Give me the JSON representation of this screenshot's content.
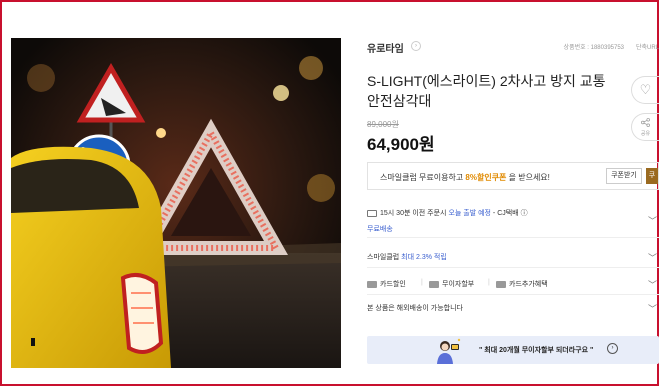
{
  "brand": {
    "name": "유로타임",
    "badge": "›"
  },
  "product_meta": {
    "product_no": "상품번호 : 1880395753",
    "short_url": "단축URL"
  },
  "title": "S-LIGHT(에스라이트) 2차사고 방지 교통 안전삼각대",
  "price": {
    "original": "89,000원",
    "sale": "64,900원"
  },
  "actions": {
    "wish_icon": "♡",
    "share_icon": "share",
    "share_label": "공유"
  },
  "coupon": {
    "text_prefix": "스마일클럽 무료이용하고 ",
    "text_highlight": "8%할인쿠폰",
    "text_suffix": " 을 받으세요!",
    "button": "쿠폰받기",
    "edge": "쿠"
  },
  "delivery": {
    "prefix": "15시 30분 이전 주문시 ",
    "highlight": "오늘 출발 예정",
    "suffix": " - CJ택배 ⓘ",
    "free": "무료배송"
  },
  "smile_club": {
    "prefix": "스마일클럽 ",
    "highlight": "최대 2.3% 적립"
  },
  "benefits": {
    "card_discount": "카드할인",
    "installment": "무이자할부",
    "card_extra": "카드추가혜택"
  },
  "overseas": "본 상품은 해외배송이 가능합니다",
  "banner": {
    "text": "\" 최대 20개월 무이자할부 되더라구요 \"",
    "arrow": "›"
  },
  "colors": {
    "frame": "#c8102e",
    "accent_blue": "#3a5fcf",
    "coupon_highlight": "#e08a00",
    "banner_bg": "#e8edf9"
  }
}
